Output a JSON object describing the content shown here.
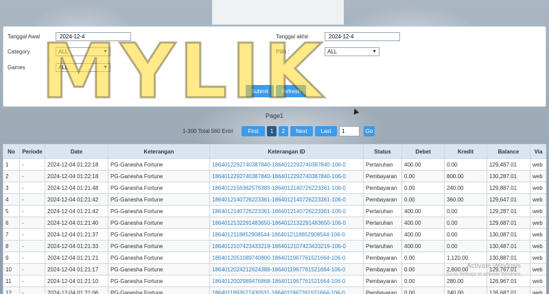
{
  "filters": {
    "start_label": "Tanggal Awal",
    "start_value": "2024-12-4",
    "end_label": "Tanggal akhir",
    "end_value": "2024-12-4",
    "category_label": "Category",
    "category_value": "ALL",
    "pilih_label": "Pilih  :",
    "pilih_value": "ALL",
    "games_label": "Games",
    "games_value": "ALL",
    "submit_label": "Submit",
    "refresh_label": "Refresh"
  },
  "pager": {
    "title": "Page1",
    "info": "1-300 Total 560 Entri",
    "first": "First",
    "page1": "1",
    "page2": "2",
    "next": "Next",
    "last": "Last",
    "input_value": "1",
    "go": "Go"
  },
  "table": {
    "headers": [
      "No",
      "Periode",
      "Date",
      "Keterangan",
      "Keterangan ID",
      "Status",
      "Debet",
      "Kredit",
      "Balance",
      "Via"
    ],
    "rows": [
      [
        "1",
        "-",
        "2024-12-04 01:22:18",
        "PG-Ganesha Fortune",
        "1864012292740387840-1864012292740387840-106-0",
        "Pertaruhan",
        "400.00",
        "0.00",
        "129,487.01",
        "web"
      ],
      [
        "2",
        "-",
        "2024-12-04 01:22:18",
        "PG-Ganesha Fortune",
        "1864012292740387840-1864012292740387840-106-0",
        "Pembayaran",
        "0.00",
        "800.00",
        "130,287.01",
        "web"
      ],
      [
        "3",
        "-",
        "2024-12-04 01:21:48",
        "PG-Ganesha Fortune",
        "1864012156362576385-1864012140726223361-106-0",
        "Pembayaran",
        "0.00",
        "240.00",
        "129,887.01",
        "web"
      ],
      [
        "4",
        "-",
        "2024-12-04 01:21:42",
        "PG-Ganesha Fortune",
        "1864012140726223361-1864012140726223361-106-0",
        "Pembayaran",
        "0.00",
        "360.00",
        "129,647.01",
        "web"
      ],
      [
        "5",
        "-",
        "2024-12-04 01:21:42",
        "PG-Ganesha Fortune",
        "1864012140726223361-1864012140726223361-106-0",
        "Pertaruhan",
        "400.00",
        "0.00",
        "129,287.01",
        "web"
      ],
      [
        "6",
        "-",
        "2024-12-04 01:21:40",
        "PG-Ganesha Fortune",
        "1864012132291483650-1864012132291483650-106-0",
        "Pertaruhan",
        "400.00",
        "0.00",
        "129,687.01",
        "web"
      ],
      [
        "7",
        "-",
        "2024-12-04 01:21:37",
        "PG-Ganesha Fortune",
        "1864012118852908544-1864012118852908544-106-0",
        "Pertaruhan",
        "400.00",
        "0.00",
        "130,087.01",
        "web"
      ],
      [
        "8",
        "-",
        "2024-12-04 01:21:33",
        "PG-Ganesha Fortune",
        "1864012107423433219-1864012107423433219-106-0",
        "Pertaruhan",
        "400.00",
        "0.00",
        "130,487.01",
        "web"
      ],
      [
        "9",
        "-",
        "2024-12-04 01:21:21",
        "PG-Ganesha Fortune",
        "1864012051089740800-1864011967761521664-106-0",
        "Pembayaran",
        "0.00",
        "1,120.00",
        "130,887.01",
        "web"
      ],
      [
        "10",
        "-",
        "2024-12-04 01:21:17",
        "PG-Ganesha Fortune",
        "1864012024212624388-1864011967761521664-106-0",
        "Pembayaran",
        "0.00",
        "2,800.00",
        "129,767.01",
        "web"
      ],
      [
        "11",
        "-",
        "2024-12-04 01:21:10",
        "PG-Ganesha Fortune",
        "1864012002989476868-1864011967761521664-106-0",
        "Pembayaran",
        "0.00",
        "280.00",
        "126,967.01",
        "web"
      ],
      [
        "12",
        "-",
        "2024-12-04 01:21:06",
        "PG-Ganesha Fortune",
        "1864011993577430531-1864011967761521664-106-0",
        "Pembayaran",
        "0.00",
        "240.00",
        "126,687.01",
        "web"
      ]
    ]
  },
  "watermark": "MYLIK",
  "os_notice": {
    "line1": "Activate Windows",
    "line2": "Go to Settings to activate Windows."
  }
}
